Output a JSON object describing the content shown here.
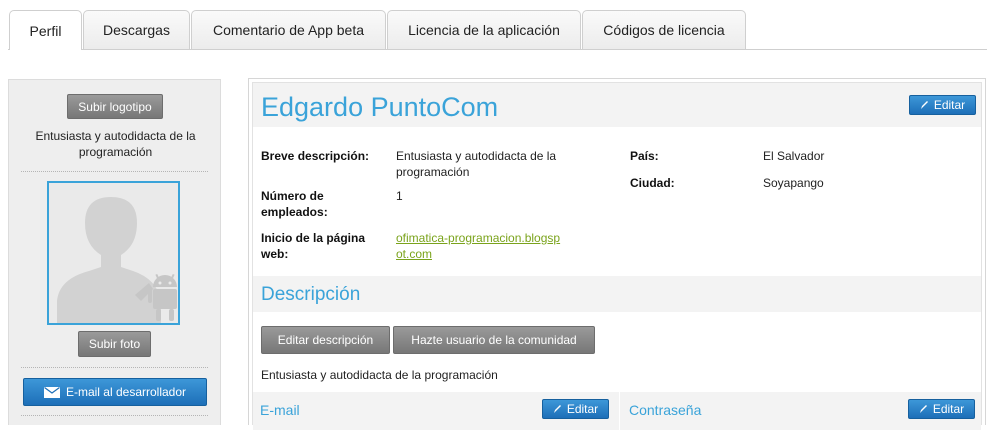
{
  "tabs": [
    {
      "label": "Perfil",
      "active": true
    },
    {
      "label": "Descargas",
      "active": false
    },
    {
      "label": "Comentario de App beta",
      "active": false
    },
    {
      "label": "Licencia de la aplicación",
      "active": false
    },
    {
      "label": "Códigos de licencia",
      "active": false
    }
  ],
  "sidebar": {
    "upload_logo_label": "Subir logotipo",
    "short_description": "Entusiasta y autodidacta de la programación",
    "upload_photo_label": "Subir foto",
    "email_developer_label": "E-mail al desarrollador"
  },
  "profile": {
    "name": "Edgardo PuntoCom",
    "edit_label": "Editar",
    "fields": {
      "brief_label": "Breve descripción:",
      "brief_value": "Entusiasta y autodidacta de la programación",
      "employees_label": "Número de empleados:",
      "employees_value": "1",
      "homepage_label": "Inicio de la página web:",
      "homepage_value": "ofimatica-programacion.blogspot.com",
      "country_label": "País:",
      "country_value": "El Salvador",
      "city_label": "Ciudad:",
      "city_value": "Soyapango"
    }
  },
  "description": {
    "title": "Descripción",
    "edit_button": "Editar descripción",
    "community_button": "Hazte usuario de la comunidad",
    "text": "Entusiasta y autodidacta de la programación"
  },
  "email_section": {
    "title": "E-mail",
    "edit_label": "Editar"
  },
  "password_section": {
    "title": "Contraseña",
    "edit_label": "Editar"
  },
  "colors": {
    "accent": "#3aa3d9",
    "button_blue": "#1d6fb8",
    "button_gray": "#888888",
    "link": "#7aa31b"
  },
  "icons": {
    "edit": "pencil-icon",
    "email": "envelope-icon",
    "placeholder": "default-avatar-android-icon"
  }
}
